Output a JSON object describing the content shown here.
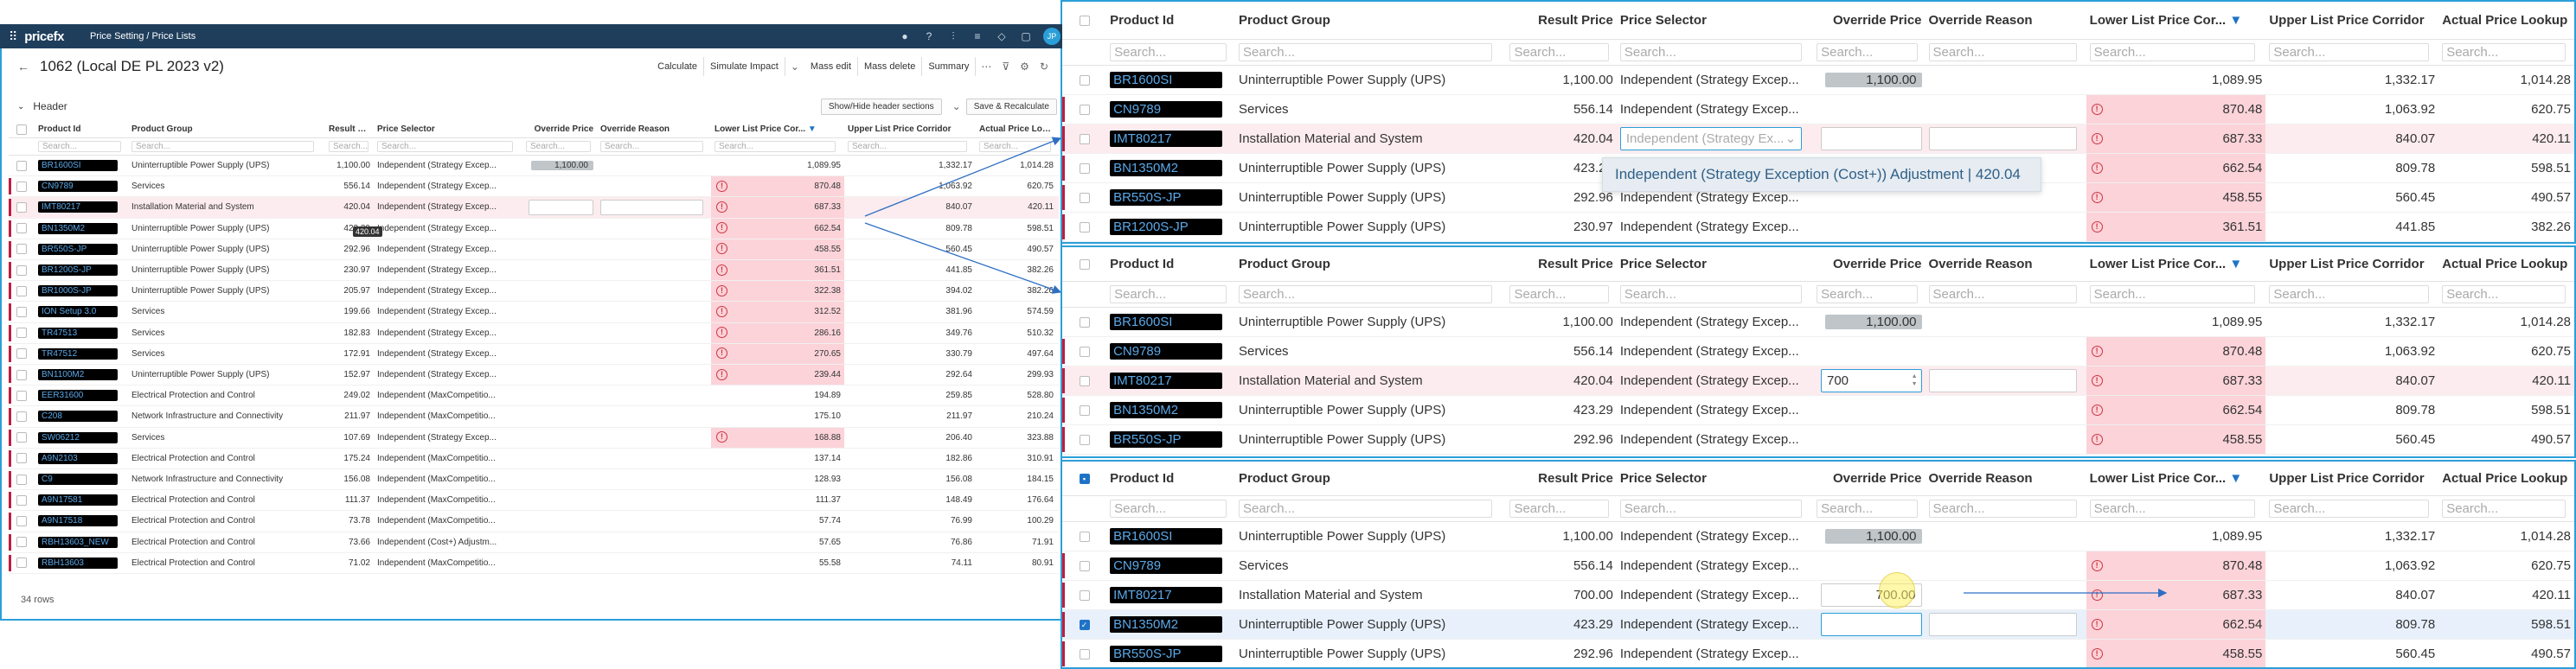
{
  "topbar": {
    "logo": "pricefx",
    "breadcrumb": "Price Setting / Price Lists",
    "avatar": "JP"
  },
  "title": {
    "text": "1062 (Local DE PL 2023 v2)"
  },
  "toolbar": {
    "calculate": "Calculate",
    "simulate": "Simulate Impact",
    "mass_edit": "Mass edit",
    "mass_delete": "Mass delete",
    "summary": "Summary"
  },
  "header_section": {
    "label": "Header",
    "show_hide": "Show/Hide header sections",
    "save_recalc": "Save & Recalculate"
  },
  "columns": {
    "product_id": "Product Id",
    "product_group": "Product Group",
    "result_price": "Result Price",
    "price_selector": "Price Selector",
    "override_price": "Override Price",
    "override_reason": "Override Reason",
    "lower_corridor": "Lower List Price Cor...",
    "upper_corridor": "Upper List Price Corridor",
    "actual_lookup": "Actual Price Lookup"
  },
  "filter_placeholder": "Search...",
  "rows": [
    {
      "id": "BR1600SI",
      "group": "Uninterruptible Power Supply (UPS)",
      "result": "1,100.00",
      "selector": "Independent (Strategy Excep...",
      "override": "1,100.00",
      "reason": "",
      "lower": "1,089.95",
      "upper": "1,332.17",
      "actual": "1,014.28",
      "warn": false,
      "flag": false
    },
    {
      "id": "CN9789",
      "group": "Services",
      "result": "556.14",
      "selector": "Independent (Strategy Excep...",
      "override": "",
      "reason": "",
      "lower": "870.48",
      "upper": "1,063.92",
      "actual": "620.75",
      "warn": true,
      "flag": true
    },
    {
      "id": "IMT80217",
      "group": "Installation Material and System",
      "result": "420.04",
      "selector": "Independent (Strategy Excep...",
      "override": "",
      "reason": "",
      "lower": "687.33",
      "upper": "840.07",
      "actual": "420.11",
      "warn": true,
      "flag": true
    },
    {
      "id": "BN1350M2",
      "group": "Uninterruptible Power Supply (UPS)",
      "result": "423.29",
      "selector": "Independent (Strategy Excep...",
      "override": "",
      "reason": "",
      "lower": "662.54",
      "upper": "809.78",
      "actual": "598.51",
      "warn": true,
      "flag": true
    },
    {
      "id": "BR550S-JP",
      "group": "Uninterruptible Power Supply (UPS)",
      "result": "292.96",
      "selector": "Independent (Strategy Excep...",
      "override": "",
      "reason": "",
      "lower": "458.55",
      "upper": "560.45",
      "actual": "490.57",
      "warn": true,
      "flag": true
    },
    {
      "id": "BR1200S-JP",
      "group": "Uninterruptible Power Supply (UPS)",
      "result": "230.97",
      "selector": "Independent (Strategy Excep...",
      "override": "",
      "reason": "",
      "lower": "361.51",
      "upper": "441.85",
      "actual": "382.26",
      "warn": true,
      "flag": true
    },
    {
      "id": "BR1000S-JP",
      "group": "Uninterruptible Power Supply (UPS)",
      "result": "205.97",
      "selector": "Independent (Strategy Excep...",
      "override": "",
      "reason": "",
      "lower": "322.38",
      "upper": "394.02",
      "actual": "382.26",
      "warn": true,
      "flag": true
    },
    {
      "id": "ION Setup 3.0",
      "group": "Services",
      "result": "199.66",
      "selector": "Independent (Strategy Excep...",
      "override": "",
      "reason": "",
      "lower": "312.52",
      "upper": "381.96",
      "actual": "574.59",
      "warn": true,
      "flag": true
    },
    {
      "id": "TR47513",
      "group": "Services",
      "result": "182.83",
      "selector": "Independent (Strategy Excep...",
      "override": "",
      "reason": "",
      "lower": "286.16",
      "upper": "349.76",
      "actual": "510.32",
      "warn": true,
      "flag": true
    },
    {
      "id": "TR47512",
      "group": "Services",
      "result": "172.91",
      "selector": "Independent (Strategy Excep...",
      "override": "",
      "reason": "",
      "lower": "270.65",
      "upper": "330.79",
      "actual": "497.64",
      "warn": true,
      "flag": true
    },
    {
      "id": "BN1100M2",
      "group": "Uninterruptible Power Supply (UPS)",
      "result": "152.97",
      "selector": "Independent (Strategy Excep...",
      "override": "",
      "reason": "",
      "lower": "239.44",
      "upper": "292.64",
      "actual": "299.93",
      "warn": true,
      "flag": true
    },
    {
      "id": "EER31600",
      "group": "Electrical Protection and Control",
      "result": "249.02",
      "selector": "Independent (MaxCompetitio...",
      "override": "",
      "reason": "",
      "lower": "194.89",
      "upper": "259.85",
      "actual": "528.80",
      "warn": false,
      "flag": true
    },
    {
      "id": "C208",
      "group": "Network Infrastructure and Connectivity",
      "result": "211.97",
      "selector": "Independent (MaxCompetitio...",
      "override": "",
      "reason": "",
      "lower": "175.10",
      "upper": "211.97",
      "actual": "210.24",
      "warn": false,
      "flag": true
    },
    {
      "id": "SW06212",
      "group": "Services",
      "result": "107.69",
      "selector": "Independent (Strategy Excep...",
      "override": "",
      "reason": "",
      "lower": "168.88",
      "upper": "206.40",
      "actual": "323.88",
      "warn": true,
      "flag": true
    },
    {
      "id": "A9N2103",
      "group": "Electrical Protection and Control",
      "result": "175.24",
      "selector": "Independent (MaxCompetitio...",
      "override": "",
      "reason": "",
      "lower": "137.14",
      "upper": "182.86",
      "actual": "310.91",
      "warn": false,
      "flag": true
    },
    {
      "id": "C9",
      "group": "Network Infrastructure and Connectivity",
      "result": "156.08",
      "selector": "Independent (MaxCompetitio...",
      "override": "",
      "reason": "",
      "lower": "128.93",
      "upper": "156.08",
      "actual": "184.15",
      "warn": false,
      "flag": true
    },
    {
      "id": "A9N17581",
      "group": "Electrical Protection and Control",
      "result": "111.37",
      "selector": "Independent (MaxCompetitio...",
      "override": "",
      "reason": "",
      "lower": "111.37",
      "upper": "148.49",
      "actual": "176.64",
      "warn": false,
      "flag": true
    },
    {
      "id": "A9N17518",
      "group": "Electrical Protection and Control",
      "result": "73.78",
      "selector": "Independent (MaxCompetitio...",
      "override": "",
      "reason": "",
      "lower": "57.74",
      "upper": "76.99",
      "actual": "100.29",
      "warn": false,
      "flag": true
    },
    {
      "id": "RBH13603_NEW",
      "group": "Electrical Protection and Control",
      "result": "73.66",
      "selector": "Independent (Cost+) Adjustm...",
      "override": "",
      "reason": "",
      "lower": "57.65",
      "upper": "76.86",
      "actual": "71.91",
      "warn": false,
      "flag": true
    },
    {
      "id": "RBH13603",
      "group": "Electrical Protection and Control",
      "result": "71.02",
      "selector": "Independent (MaxCompetitio...",
      "override": "",
      "reason": "",
      "lower": "55.58",
      "upper": "74.11",
      "actual": "80.91",
      "warn": false,
      "flag": true
    }
  ],
  "row_count": "34 rows",
  "tooltip_left": "420.04",
  "panel1": {
    "dropdown_placeholder": "Independent (Strategy Ex...",
    "dropdown_option": "Independent (Strategy Exception (Cost+)) Adjustment | 420.04"
  },
  "panel2": {
    "edit_value": "700"
  },
  "panel3": {
    "new_result": "700.00",
    "override_value": "700.00"
  }
}
